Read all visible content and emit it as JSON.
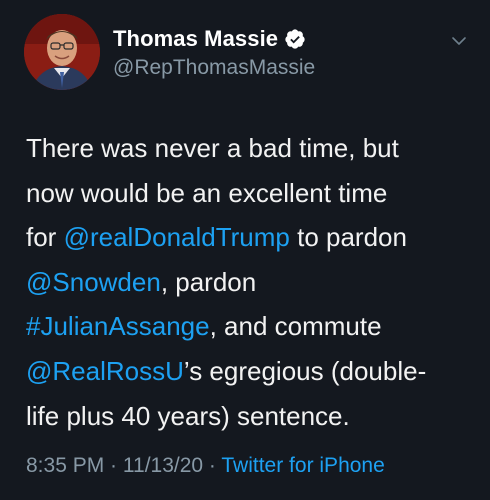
{
  "author": {
    "display_name": "Thomas Massie",
    "handle": "@RepThomasMassie",
    "avatar_icon": "profile-photo",
    "verified_icon": "verified-badge-icon"
  },
  "menu": {
    "caret_icon": "chevron-down-icon"
  },
  "tweet": {
    "lines": [
      [
        {
          "t": "There was never a bad time, but",
          "link": false
        }
      ],
      [
        {
          "t": "now would be an excellent time",
          "link": false
        }
      ],
      [
        {
          "t": "for ",
          "link": false
        },
        {
          "t": "@realDonaldTrump",
          "link": true
        },
        {
          "t": " to pardon",
          "link": false
        }
      ],
      [
        {
          "t": "@Snowden",
          "link": true
        },
        {
          "t": ", pardon",
          "link": false
        }
      ],
      [
        {
          "t": "#JulianAssange",
          "link": true
        },
        {
          "t": ", and commute",
          "link": false
        }
      ],
      [
        {
          "t": "@RealRossU",
          "link": true
        },
        {
          "t": "’s egregious (double-",
          "link": false
        }
      ],
      [
        {
          "t": "life plus 40 years) sentence.",
          "link": false
        }
      ]
    ]
  },
  "meta": {
    "time": "8:35 PM",
    "sep1": " · ",
    "date": "11/13/20",
    "sep2": " · ",
    "source": "Twitter for iPhone"
  },
  "colors": {
    "background": "#14181f",
    "link": "#1da1f2",
    "muted": "#8899a6"
  }
}
